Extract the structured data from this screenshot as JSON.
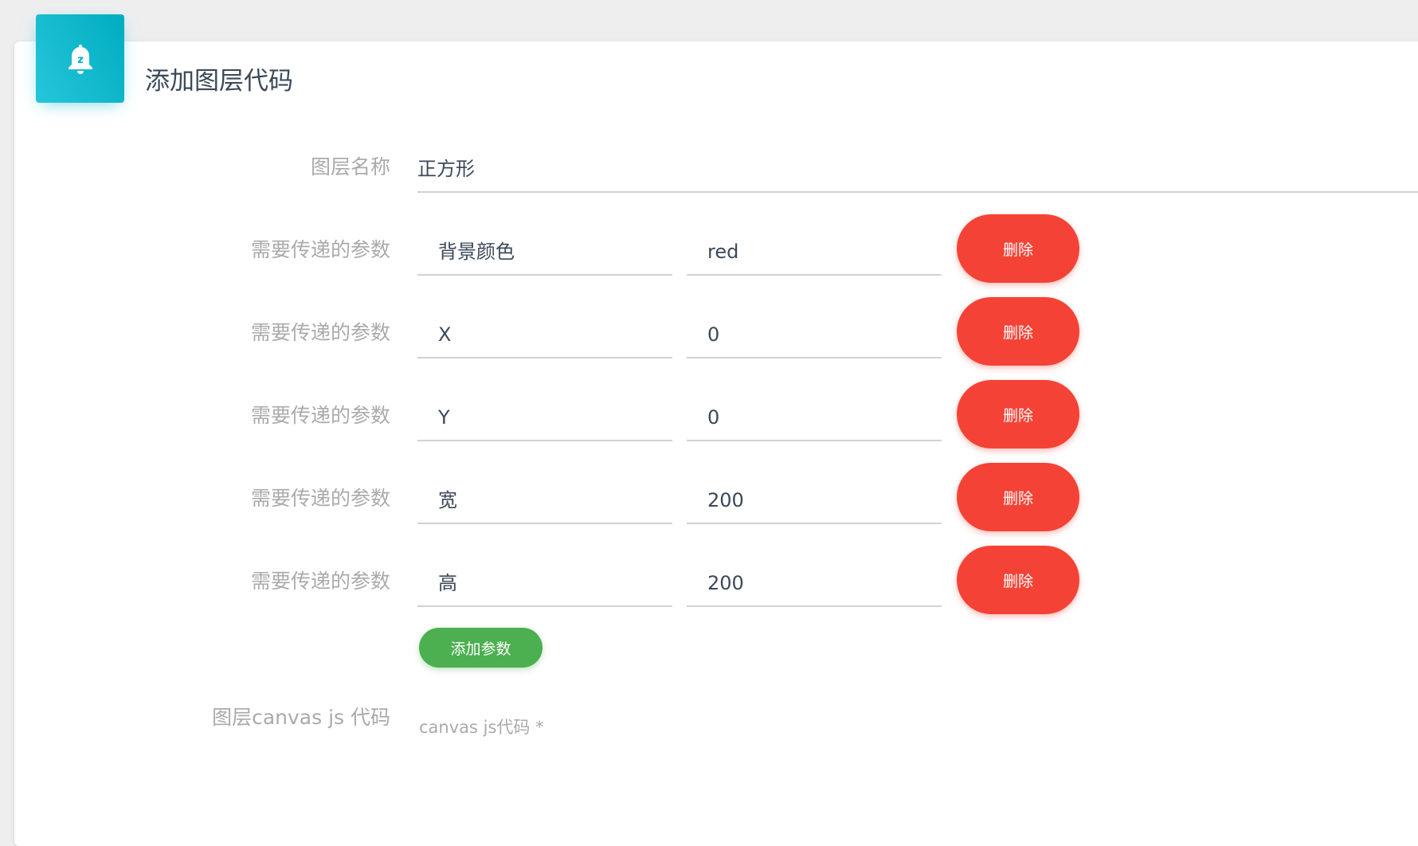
{
  "card": {
    "icon": "bell-icon",
    "icon_badge": "z",
    "title": "添加图层代码"
  },
  "layer_name": {
    "label": "图层名称",
    "value": "正方形"
  },
  "params": [
    {
      "label": "需要传递的参数",
      "key": "背景颜色",
      "value": "red",
      "delete_label": "删除"
    },
    {
      "label": "需要传递的参数",
      "key": "X",
      "value": "0",
      "delete_label": "删除"
    },
    {
      "label": "需要传递的参数",
      "key": "Y",
      "value": "0",
      "delete_label": "删除"
    },
    {
      "label": "需要传递的参数",
      "key": "宽",
      "value": "200",
      "delete_label": "删除"
    },
    {
      "label": "需要传递的参数",
      "key": "高",
      "value": "200",
      "delete_label": "删除"
    }
  ],
  "add_param_label": "添加参数",
  "canvas_code": {
    "label": "图层canvas js 代码",
    "placeholder": "canvas js代码 *"
  },
  "colors": {
    "accent": "#00acc1",
    "danger": "#f44336",
    "success": "#4caf50"
  }
}
